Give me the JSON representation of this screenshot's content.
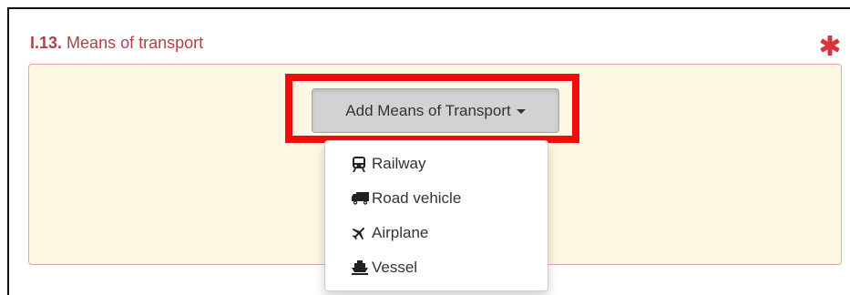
{
  "section": {
    "number": "I.13.",
    "title": "Means of transport"
  },
  "required_marker": {
    "icon": "asterisk-icon",
    "color": "#d9333f"
  },
  "add_button": {
    "label": "Add Means of Transport"
  },
  "dropdown": {
    "items": [
      {
        "label": "Railway",
        "icon": "train-icon"
      },
      {
        "label": "Road vehicle",
        "icon": "truck-icon"
      },
      {
        "label": "Airplane",
        "icon": "plane-icon"
      },
      {
        "label": "Vessel",
        "icon": "ship-icon"
      }
    ]
  },
  "colors": {
    "title": "#b0414b",
    "panel_background": "#fcf8e3",
    "highlight": "#f20d0d"
  }
}
